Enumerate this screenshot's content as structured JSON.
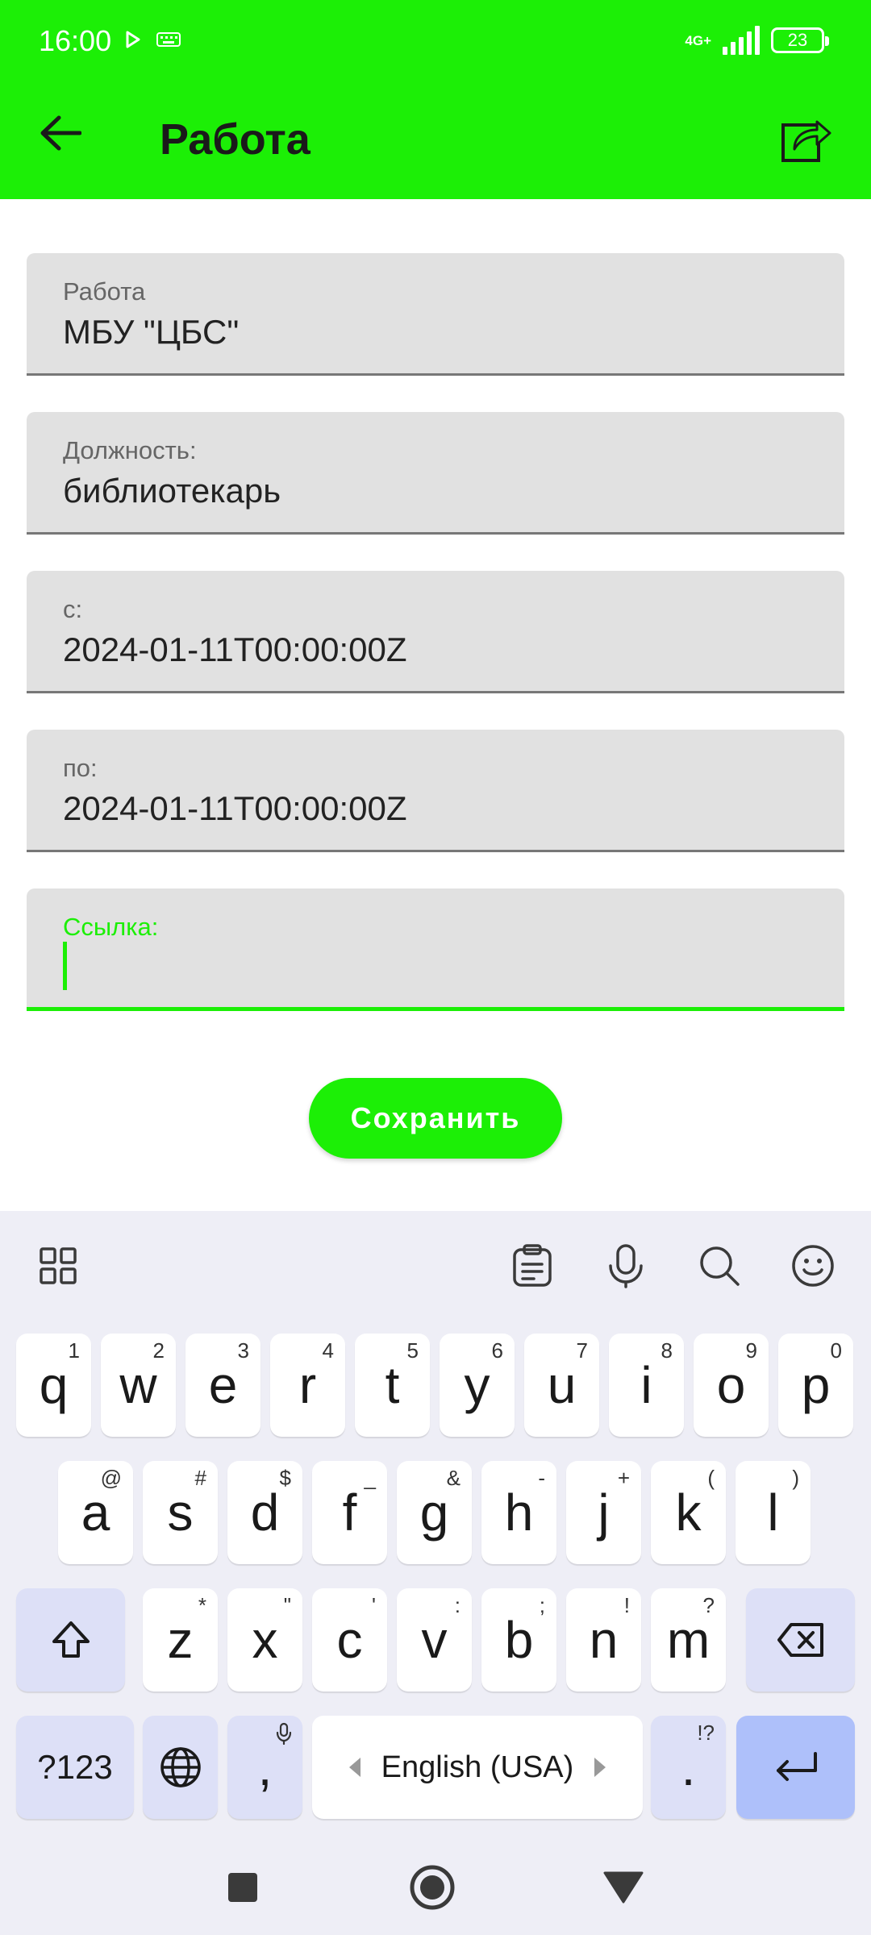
{
  "status_bar": {
    "time": "16:00",
    "network": "4G+",
    "battery": "23"
  },
  "header": {
    "title": "Работа"
  },
  "form": {
    "fields": [
      {
        "label": "Работа",
        "value": "МБУ \"ЦБС\""
      },
      {
        "label": "Должность:",
        "value": "библиотекарь"
      },
      {
        "label": "с:",
        "value": "2024-01-11T00:00:00Z"
      },
      {
        "label": "по:",
        "value": "2024-01-11T00:00:00Z"
      },
      {
        "label": "Ссылка:",
        "value": ""
      }
    ],
    "save_label": "Сохранить"
  },
  "keyboard": {
    "row1": [
      {
        "key": "q",
        "hint": "1"
      },
      {
        "key": "w",
        "hint": "2"
      },
      {
        "key": "e",
        "hint": "3"
      },
      {
        "key": "r",
        "hint": "4"
      },
      {
        "key": "t",
        "hint": "5"
      },
      {
        "key": "y",
        "hint": "6"
      },
      {
        "key": "u",
        "hint": "7"
      },
      {
        "key": "i",
        "hint": "8"
      },
      {
        "key": "o",
        "hint": "9"
      },
      {
        "key": "p",
        "hint": "0"
      }
    ],
    "row2": [
      {
        "key": "a",
        "hint": "@"
      },
      {
        "key": "s",
        "hint": "#"
      },
      {
        "key": "d",
        "hint": "$"
      },
      {
        "key": "f",
        "hint": "_"
      },
      {
        "key": "g",
        "hint": "&"
      },
      {
        "key": "h",
        "hint": "-"
      },
      {
        "key": "j",
        "hint": "+"
      },
      {
        "key": "k",
        "hint": "("
      },
      {
        "key": "l",
        "hint": ")"
      }
    ],
    "row3": [
      {
        "key": "z",
        "hint": "*"
      },
      {
        "key": "x",
        "hint": "\""
      },
      {
        "key": "c",
        "hint": "'"
      },
      {
        "key": "v",
        "hint": ":"
      },
      {
        "key": "b",
        "hint": ";"
      },
      {
        "key": "n",
        "hint": "!"
      },
      {
        "key": "m",
        "hint": "?"
      }
    ],
    "symbols_label": "?123",
    "comma": ",",
    "space_label": "English (USA)",
    "period": ".",
    "period_hint": "!?"
  },
  "colors": {
    "accent": "#1cef06",
    "field_bg": "#e1e1e1",
    "keyboard_bg": "#eeeef6",
    "function_key": "#dde0f7",
    "enter_key": "#aec0fa"
  }
}
